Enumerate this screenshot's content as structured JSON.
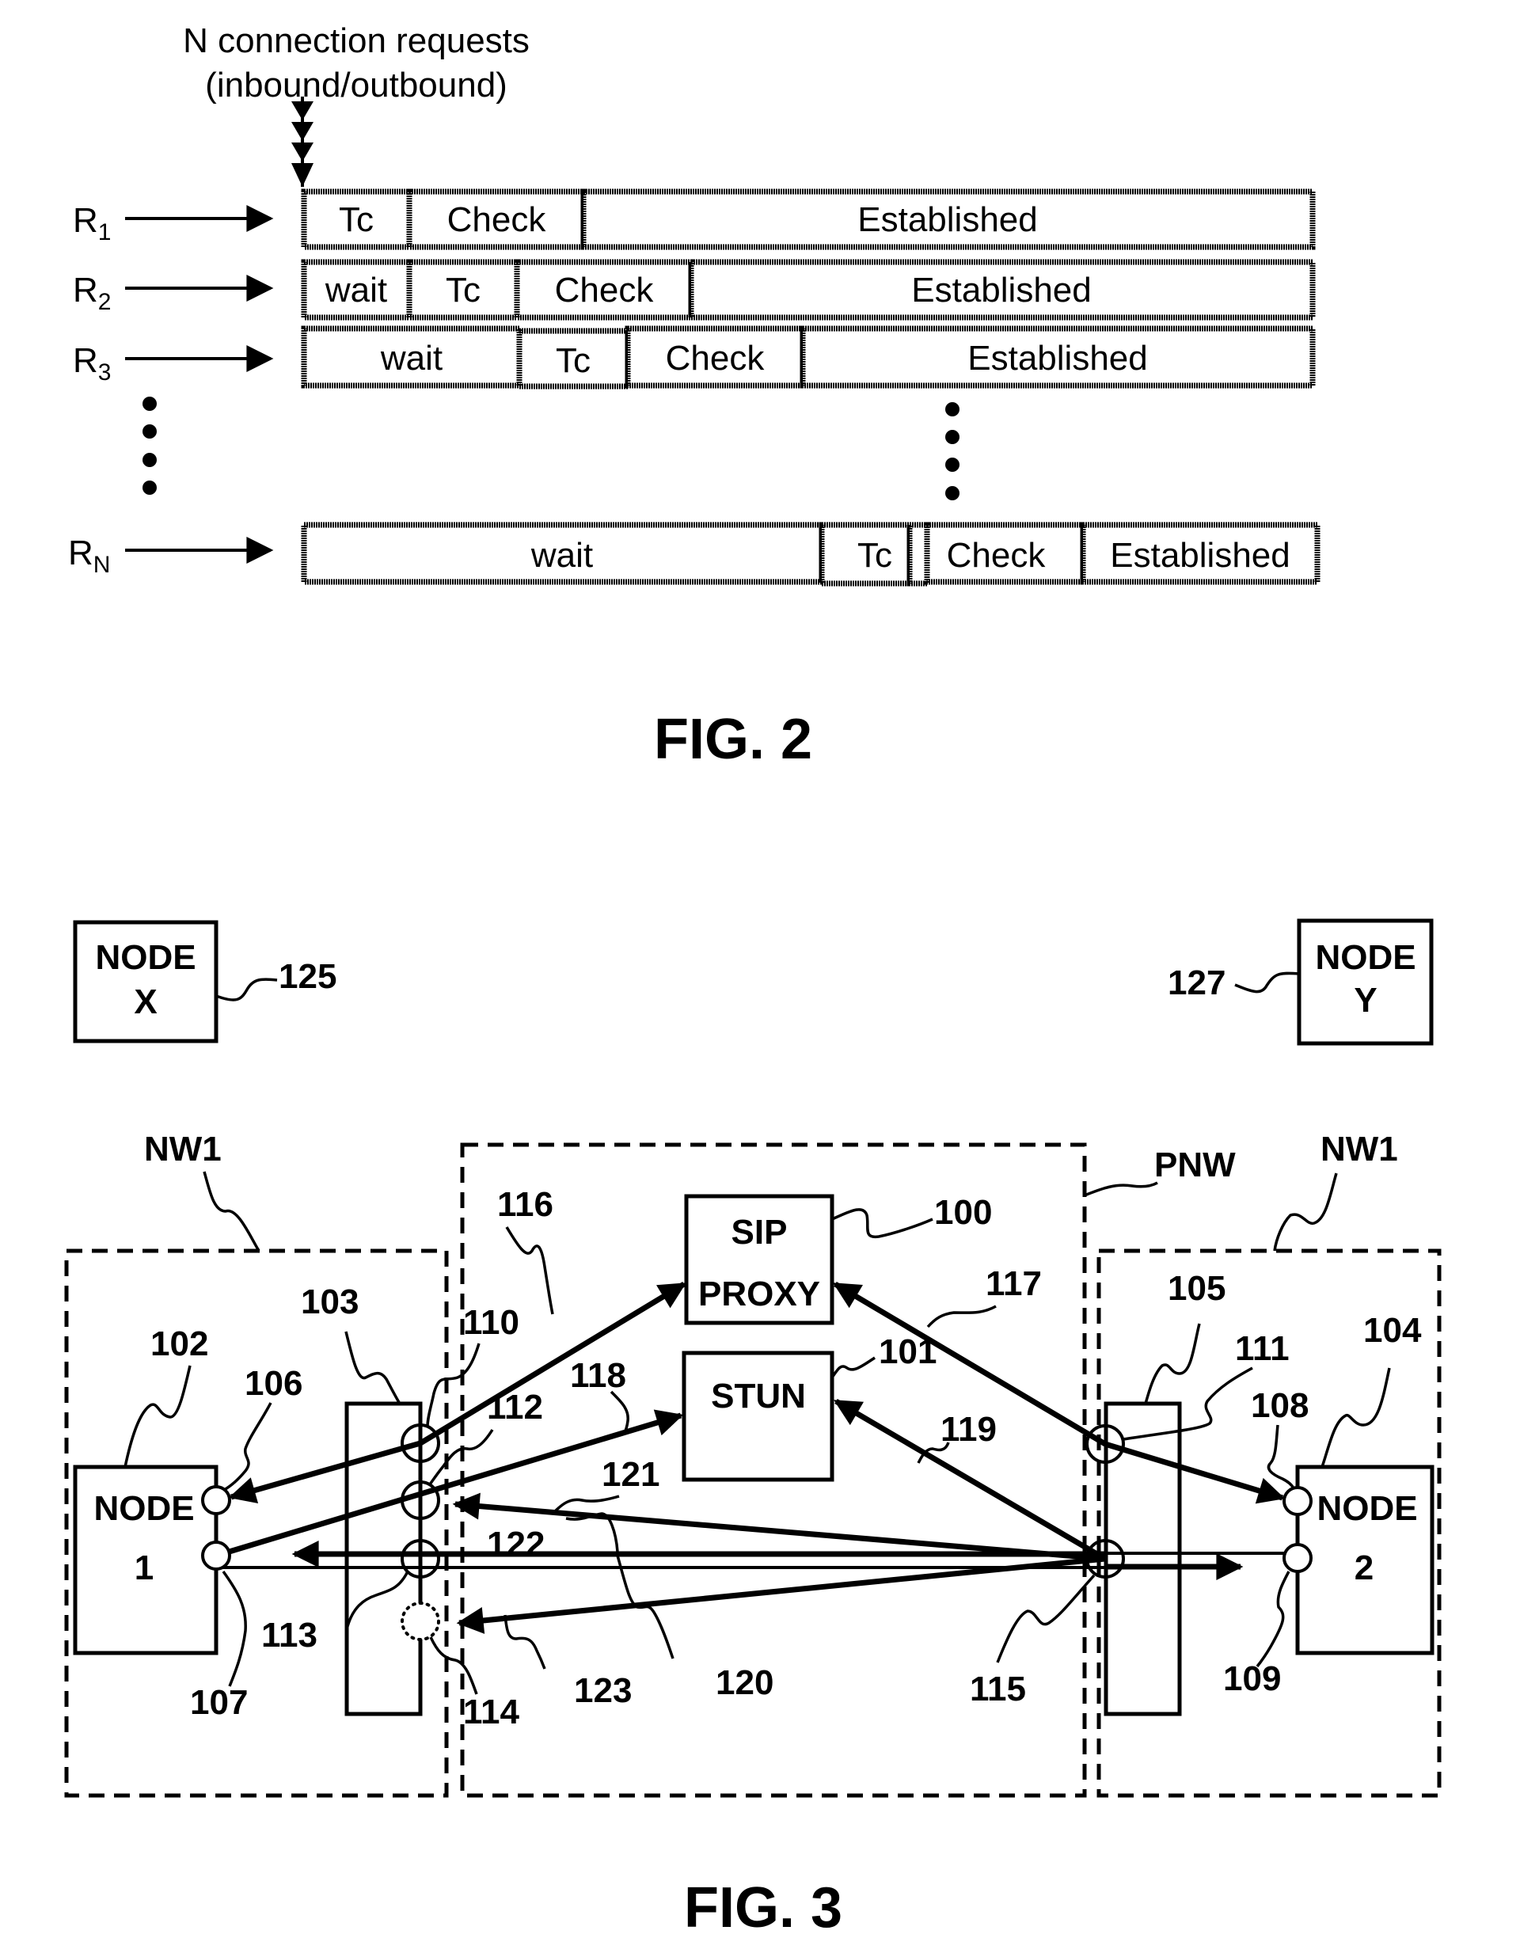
{
  "fig2": {
    "caption": "FIG. 2",
    "title_line1": "N connection requests",
    "title_line2": "(inbound/outbound)",
    "rows": [
      {
        "label": "R",
        "sub": "1",
        "segments": [
          "Tc",
          "Check",
          "Established"
        ]
      },
      {
        "label": "R",
        "sub": "2",
        "segments": [
          "wait",
          "Tc",
          "Check",
          "Established"
        ]
      },
      {
        "label": "R",
        "sub": "3",
        "segments": [
          "wait",
          "Tc",
          "Check",
          "Established"
        ]
      },
      {
        "label": "R",
        "sub": "N",
        "segments": [
          "wait",
          "Tc",
          "",
          "Check",
          "Established"
        ]
      }
    ]
  },
  "fig3": {
    "caption": "FIG. 3",
    "node_x": {
      "line1": "NODE",
      "line2": "X",
      "ref": "125"
    },
    "node_y": {
      "line1": "NODE",
      "line2": "Y",
      "ref": "127"
    },
    "node_1": {
      "line1": "NODE",
      "line2": "1",
      "ref": "102"
    },
    "node_2": {
      "line1": "NODE",
      "line2": "2",
      "ref": "104"
    },
    "sip_proxy": {
      "line1": "SIP",
      "line2": "PROXY",
      "ref": "100"
    },
    "stun": {
      "line1": "STUN",
      "ref": "101"
    },
    "networks": {
      "left": "NW1",
      "public": "PNW",
      "right": "NW1"
    },
    "nat_left_ref": "103",
    "nat_right_ref": "105",
    "refs": {
      "r106": "106",
      "r107": "107",
      "r108": "108",
      "r109": "109",
      "r110": "110",
      "r111": "111",
      "r112": "112",
      "r113": "113",
      "r114": "114",
      "r115": "115",
      "r116": "116",
      "r117": "117",
      "r118": "118",
      "r119": "119",
      "r120": "120",
      "r121": "121",
      "r122": "122",
      "r123": "123"
    }
  }
}
